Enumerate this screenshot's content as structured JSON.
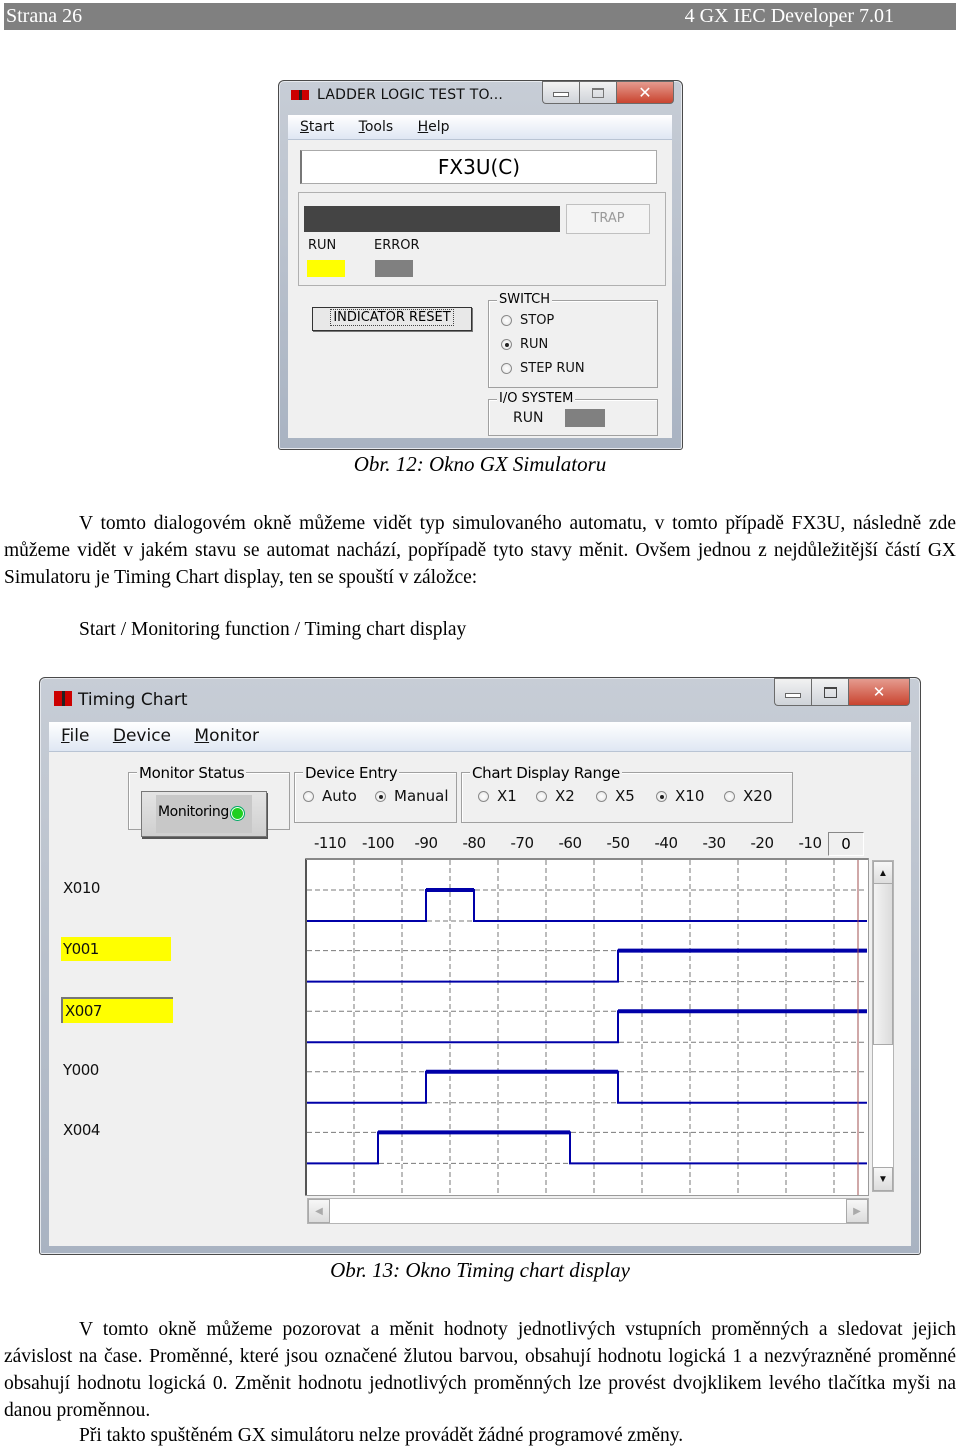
{
  "page_header": {
    "left": "Strana 26",
    "right": "4 GX IEC Developer 7.01"
  },
  "simulator_window": {
    "title": "LADDER LOGIC TEST TO...",
    "menu": [
      {
        "key": "S",
        "rest": "tart"
      },
      {
        "key": "T",
        "rest": "ools"
      },
      {
        "key": "H",
        "rest": "elp"
      }
    ],
    "plc_type": "FX3U(C)",
    "trap_label": "TRAP",
    "run_label": "RUN",
    "error_label": "ERROR",
    "run_led_color": "#ffff00",
    "error_led_color": "#808080",
    "indicator_reset_label": "INDICATOR RESET",
    "switch": {
      "legend": "SWITCH",
      "options": [
        {
          "label": "STOP",
          "selected": false
        },
        {
          "label": "RUN",
          "selected": true
        },
        {
          "label": "STEP RUN",
          "selected": false
        }
      ]
    },
    "io_system": {
      "legend": "I/O SYSTEM",
      "run_label": "RUN",
      "led_color": "#808080"
    }
  },
  "caption_12": "Obr. 12: Okno GX Simulatoru",
  "paragraph_1": "V tomto dialogovém okně můžeme vidět typ simulovaného automatu, v tomto případě FX3U, následně zde můžeme vidět v jakém stavu se automat nachází, popřípadě tyto stavy měnit. Ovšem jednou z nejdůležitější částí GX Simulatoru je Timing Chart display, ten se spouští v záložce:",
  "menu_path": "Start / Monitoring function / Timing chart display",
  "timing_chart_window": {
    "title": "Timing Chart",
    "menu": [
      {
        "key": "F",
        "rest": "ile"
      },
      {
        "key": "D",
        "rest": "evice"
      },
      {
        "key": "M",
        "rest": "onitor"
      }
    ],
    "monitor_status": {
      "legend": "Monitor Status",
      "button_label": "Monitoring",
      "led_color": "#20d020"
    },
    "device_entry": {
      "legend": "Device Entry",
      "options": [
        {
          "label": "Auto",
          "selected": false
        },
        {
          "label": "Manual",
          "selected": true
        }
      ]
    },
    "chart_display_range": {
      "legend": "Chart Display Range",
      "options": [
        {
          "label": "X1",
          "selected": false
        },
        {
          "label": "X2",
          "selected": false
        },
        {
          "label": "X5",
          "selected": false
        },
        {
          "label": "X10",
          "selected": true
        },
        {
          "label": "X20",
          "selected": false
        }
      ]
    },
    "current_time_value": "0"
  },
  "chart_data": {
    "type": "timing",
    "title": "Timing Chart",
    "x_ticks": [
      "-110",
      "-100",
      "-90",
      "-80",
      "-70",
      "-60",
      "-50",
      "-40",
      "-30",
      "-20",
      "-10"
    ],
    "xlim": [
      -115,
      0
    ],
    "current_time": 0,
    "grid": true,
    "signal_color": "#0000a8",
    "cursor_color": "#a05050",
    "highlight_color": "#ffff00",
    "signals": [
      {
        "name": "X010",
        "highlighted": false,
        "current_value": 0,
        "high_intervals": [
          [
            -90,
            -80
          ]
        ]
      },
      {
        "name": "Y001",
        "highlighted": true,
        "current_value": 1,
        "high_intervals": [
          [
            -50,
            0
          ]
        ]
      },
      {
        "name": "X007",
        "highlighted": true,
        "current_value": 1,
        "selected": true,
        "high_intervals": [
          [
            -50,
            0
          ]
        ]
      },
      {
        "name": "Y000",
        "highlighted": false,
        "current_value": 0,
        "high_intervals": [
          [
            -90,
            -50
          ]
        ]
      },
      {
        "name": "X004",
        "highlighted": false,
        "current_value": 0,
        "high_intervals": [
          [
            -100,
            -60
          ]
        ]
      }
    ]
  },
  "caption_13": "Obr. 13: Okno Timing chart display",
  "paragraph_2": "V tomto okně můžeme pozorovat a měnit hodnoty jednotlivých vstupních proměnných a sledovat jejich závislost na čase. Proměnné, které jsou označené žlutou barvou, obsahují hodnotu logická 1 a nezvýrazněné proměnné obsahují hodnotu logická 0. Změnit hodnotu jednotlivých proměnných lze provést dvojklikem levého tlačítka myši na danou proměnnou.",
  "paragraph_3": "Při takto spuštěném GX simulátoru nelze provádět žádné programové změny."
}
